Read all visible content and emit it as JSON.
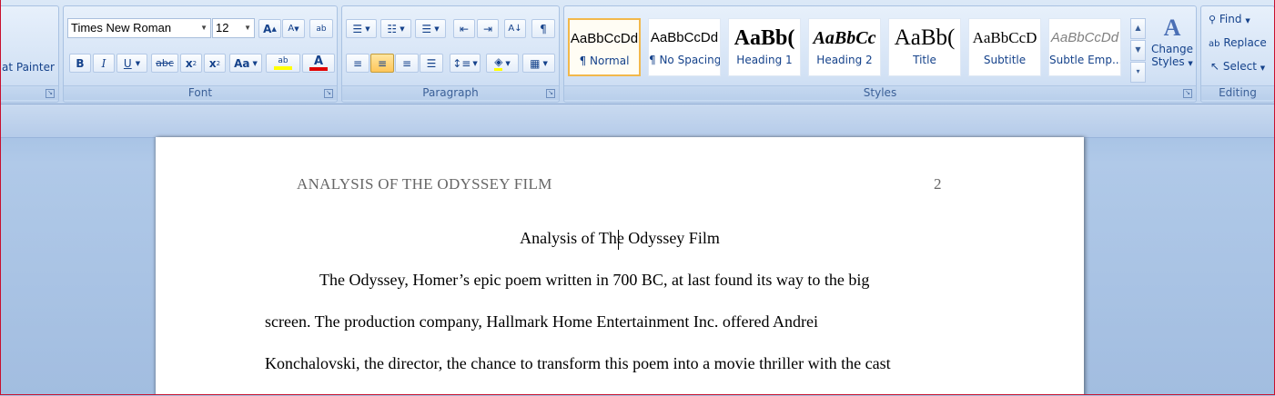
{
  "clipboard": {
    "format_painter_label": "at Painter"
  },
  "font": {
    "group_label": "Font",
    "font_name": "Times New Roman",
    "font_size": "12",
    "grow_label": "A",
    "shrink_label": "A",
    "clear_label": "ab",
    "bold": "B",
    "italic": "I",
    "underline": "U",
    "strike": "abc",
    "subscript": "x",
    "superscript": "x",
    "change_case": "Aa",
    "highlight_label": "ab",
    "font_color_label": "A"
  },
  "paragraph": {
    "group_label": "Paragraph",
    "pilcrow": "¶"
  },
  "styles": {
    "group_label": "Styles",
    "tiles": [
      {
        "sample": "AaBbCcDd",
        "name": "¶ Normal"
      },
      {
        "sample": "AaBbCcDd",
        "name": "¶ No Spacing"
      },
      {
        "sample": "AaBb(",
        "name": "Heading 1"
      },
      {
        "sample": "AaBbCc",
        "name": "Heading 2"
      },
      {
        "sample": "AaBb(",
        "name": "Title"
      },
      {
        "sample": "AaBbCcD",
        "name": "Subtitle"
      },
      {
        "sample": "AaBbCcDd",
        "name": "Subtle Emp..."
      }
    ],
    "change_styles_line1": "Change",
    "change_styles_line2": "Styles"
  },
  "editing": {
    "group_label": "Editing",
    "find": "Find",
    "replace": "Replace",
    "select": "Select"
  },
  "document": {
    "header": "ANALYSIS OF THE ODYSSEY FILM",
    "page_number": "2",
    "title": "Analysis of The Odyssey Film",
    "lines": [
      "The Odyssey, Homer’s epic poem written in 700 BC, at last found its way to the big",
      "screen. The production company, Hallmark Home Entertainment Inc. offered Andrei",
      "Konchalovski, the director, the chance to transform this poem into a movie thriller with the cast"
    ]
  },
  "colors": {
    "accent": "#15428b",
    "highlight": "#ffff00",
    "font_color": "#e00000"
  }
}
